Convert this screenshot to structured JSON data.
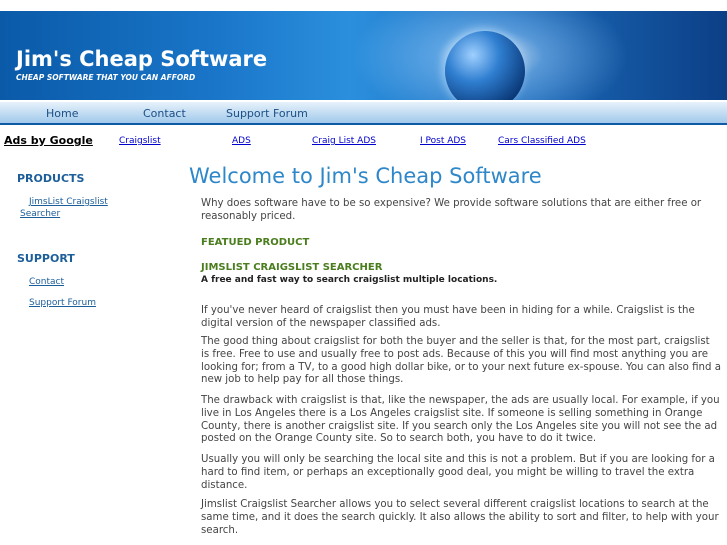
{
  "header": {
    "title": "Jim's Cheap Software",
    "tagline": "CHEAP SOFTWARE THAT YOU CAN AFFORD"
  },
  "nav": {
    "home": "Home",
    "contact": "Contact",
    "support_forum": "Support Forum"
  },
  "ads": {
    "ads_by_google": "Ads by Google",
    "links": [
      "Craigslist",
      "ADS",
      "Craig List ADS",
      "I Post ADS",
      "Cars Classified ADS"
    ]
  },
  "sidebar": {
    "products_heading": "PRODUCTS",
    "products_link": "JimsList Craigslist Searcher",
    "support_heading": "SUPPORT",
    "support_contact": "Contact",
    "support_forum": "Support Forum"
  },
  "main": {
    "heading": "Welcome to Jim's Cheap Software",
    "intro": "Why does software have to be so expensive? We provide software solutions that are either free or reasonably priced.",
    "featured_label": "FEATUED PRODUCT",
    "product_name": "JIMSLIST CRAIGSLIST SEARCHER",
    "product_tagline": "A free and fast way to search craigslist multiple locations.",
    "paragraphs": [
      "If you've never heard of craigslist then you must have been in hiding for a while. Craigslist is the digital version of the newspaper classified ads.",
      "The good thing about craigslist for both the buyer and the seller is that, for the most part, craigslist is free. Free to use and usually free to post ads. Because of this you will find most anything you are looking for; from a TV, to a good high dollar bike, or to your next future ex-spouse. You can also find a new job to help pay for all those things.",
      "The drawback with craigslist is that, like the newspaper, the ads are usually local. For example, if you live in Los Angeles there is a Los Angeles craigslist site. If someone is selling something in Orange County, there is another craigslist site. If you search only the Los Angeles site you will not see the ad posted on the Orange County site. So to search both, you have to do it twice.",
      "Usually you will only be searching the local site and this is not a problem. But if you are looking for a hard to find item, or perhaps an exceptionally good deal, you might be willing to travel the extra distance.",
      "Jimslist Craigslist Searcher allows you to select several different craigslist locations to search at the same time, and it does the search quickly. It also allows the ability to sort and filter, to help with your search."
    ]
  }
}
